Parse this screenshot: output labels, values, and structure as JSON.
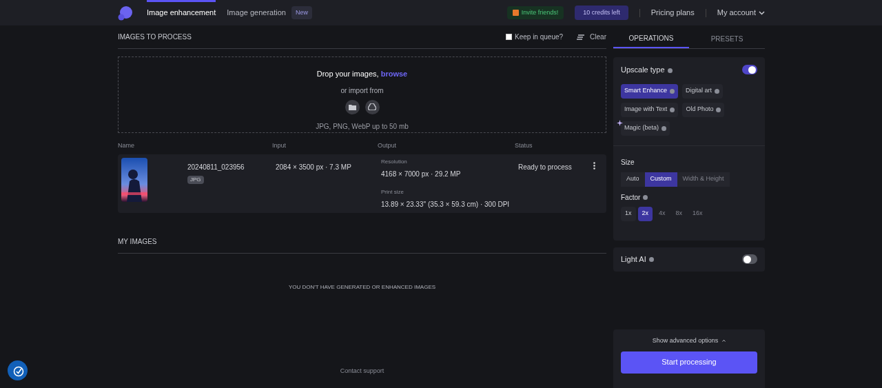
{
  "nav": {
    "tabs": [
      {
        "label": "Image enhancement",
        "selected": true
      },
      {
        "label": "Image generation",
        "selected": false,
        "badge": "New"
      }
    ],
    "invite": "Invite friends!",
    "credits": "10 credits left",
    "pricing": "Pricing plans",
    "account": "My account"
  },
  "queue": {
    "title": "IMAGES TO PROCESS",
    "keep_in_queue": {
      "label": "Keep in queue?",
      "checked": false
    },
    "clear": "Clear",
    "dropzone": {
      "text": "Drop your images, ",
      "link": "browse",
      "import_text": "or import from",
      "formats": "JPG, PNG, WebP up to 50 mb"
    },
    "columns": [
      "Name",
      "Input",
      "Output",
      "Status"
    ],
    "rows": [
      {
        "name": "20240811_023956",
        "type": "JPG",
        "input": "2084 × 3500 px · 7.3 MP",
        "resolution_label": "Resolution",
        "resolution": "4168 × 7000 px · 29.2 MP",
        "print_label": "Print size",
        "print_size": "13.89 × 23.33'' (35.3 × 59.3 cm) · 300 DPI",
        "status": "Ready to process"
      }
    ]
  },
  "my_images": {
    "title": "MY IMAGES",
    "empty": "YOU DON'T HAVE GENERATED OR ENHANCED IMAGES"
  },
  "footer": {
    "contact": "Contact support"
  },
  "panel": {
    "tabs": [
      {
        "label": "OPERATIONS",
        "selected": true
      },
      {
        "label": "PRESETS",
        "selected": false
      }
    ],
    "upscale": {
      "title": "Upscale type",
      "on": true,
      "options": [
        {
          "label": "Smart Enhance",
          "selected": true
        },
        {
          "label": "Digital art",
          "selected": false
        },
        {
          "label": "Image with Text",
          "selected": false
        },
        {
          "label": "Old Photo",
          "selected": false
        },
        {
          "label": "Magic (beta)",
          "selected": false
        }
      ]
    },
    "size": {
      "title": "Size",
      "modes": [
        {
          "label": "Auto",
          "selected": false,
          "disabled": false
        },
        {
          "label": "Custom",
          "selected": true,
          "disabled": false
        },
        {
          "label": "Width & Height",
          "selected": false,
          "disabled": true
        }
      ],
      "factor_title": "Factor",
      "factors": [
        {
          "label": "1x",
          "selected": false,
          "disabled": false
        },
        {
          "label": "2x",
          "selected": true,
          "disabled": false
        },
        {
          "label": "4x",
          "selected": false,
          "disabled": true
        },
        {
          "label": "8x",
          "selected": false,
          "disabled": true
        },
        {
          "label": "16x",
          "selected": false,
          "disabled": true
        }
      ]
    },
    "light_ai": {
      "title": "Light AI",
      "on": false
    },
    "advanced": "Show advanced options",
    "start": "Start processing"
  }
}
